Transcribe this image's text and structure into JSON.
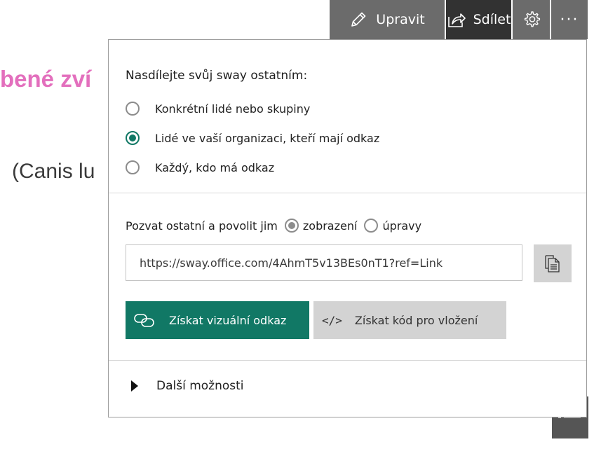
{
  "background": {
    "heading": "bené zví",
    "subtext": "(Canis lu"
  },
  "toolbar": {
    "edit_label": "Upravit",
    "share_label": "Sdílet",
    "settings_icon": "gear-icon",
    "more_label": "···"
  },
  "share_panel": {
    "title": "Nasdílejte svůj sway ostatním:",
    "audience_options": [
      {
        "label": "Konkrétní lidé nebo skupiny",
        "selected": false
      },
      {
        "label": "Lidé ve vaší organizaci, kteří mají odkaz",
        "selected": true
      },
      {
        "label": "Každý, kdo má odkaz",
        "selected": false
      }
    ],
    "invite_label": "Pozvat ostatní a povolit jim",
    "permission_options": [
      {
        "label": "zobrazení",
        "selected": true
      },
      {
        "label": "úpravy",
        "selected": false
      }
    ],
    "link_value": "https://sway.office.com/4AhmT5v13BEs0nT1?ref=Link",
    "visual_link_button": "Získat vizuální odkaz",
    "embed_icon": "</>",
    "embed_button": "Získat kód pro vložení",
    "more_options": "Další možnosti"
  },
  "colors": {
    "accent": "#117865",
    "toolbar_bg": "#6b6b6b",
    "toolbar_active": "#323232",
    "heading_pink": "#e36fbd"
  }
}
